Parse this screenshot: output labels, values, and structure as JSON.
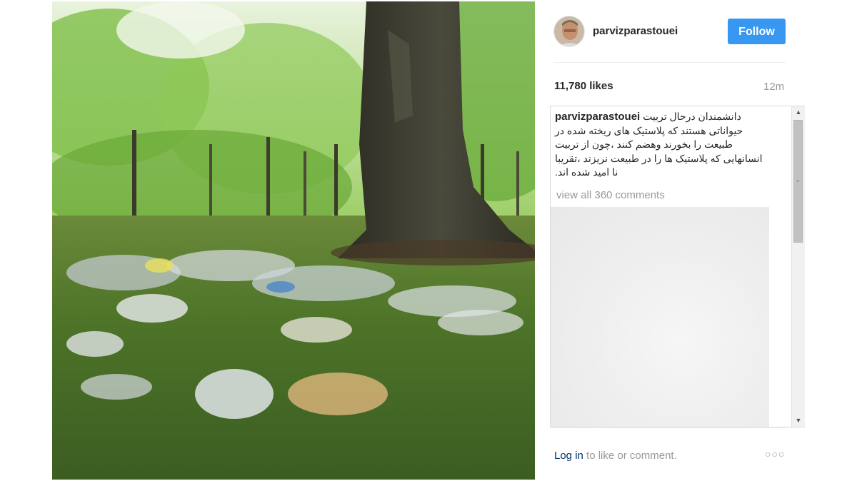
{
  "post": {
    "username": "parvizparastouei",
    "follow_label": "Follow",
    "likes": "11,780 likes",
    "time": "12m",
    "caption_user": "parvizparastouei",
    "caption_text": "دانشمندان درحال تربیت حیواناتی هستند که پلاستیک های ریخته شده در طبیعت را بخورند وهضم کنند ،چون از تربیت انسانهایی که پلاستیک ها را در طبیعت نریزند ،تقریبا نا امید شده اند.",
    "view_all": "view all 360 comments",
    "login_link": "Log in",
    "login_rest": " to like or comment.",
    "more_label": "○○○"
  },
  "icons": {
    "scroll_up": "▲",
    "scroll_down": "▼",
    "grip": "≡"
  },
  "colors": {
    "follow_bg": "#3897f0",
    "link": "#003569",
    "muted": "#999999"
  }
}
